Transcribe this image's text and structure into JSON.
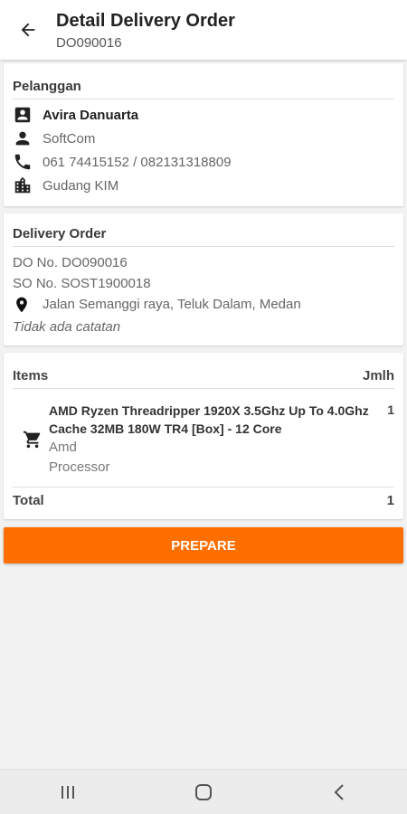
{
  "header": {
    "title": "Detail Delivery Order",
    "subtitle": "DO090016",
    "back_icon": "arrow-back-icon"
  },
  "customer": {
    "section_title": "Pelanggan",
    "name": "Avira Danuarta",
    "company": "SoftCom",
    "phone": "061 74415152 / 082131318809",
    "warehouse": "Gudang KIM"
  },
  "delivery": {
    "section_title": "Delivery Order",
    "do_number": "DO No. DO090016",
    "so_number": "SO No. SOST1900018",
    "address": "Jalan Semanggi raya, Teluk Dalam, Medan",
    "note": "Tidak ada catatan"
  },
  "items": {
    "header_label": "Items",
    "header_qty": "Jmlh",
    "list": [
      {
        "name": "AMD Ryzen Threadripper 1920X 3.5Ghz Up To 4.0Ghz Cache 32MB 180W TR4 [Box] - 12 Core",
        "brand": "Amd",
        "category": "Processor",
        "qty": "1"
      }
    ],
    "total_label": "Total",
    "total_qty": "1"
  },
  "actions": {
    "prepare_label": "PREPARE"
  },
  "colors": {
    "accent": "#ff6f00",
    "background": "#f2f2f2"
  }
}
